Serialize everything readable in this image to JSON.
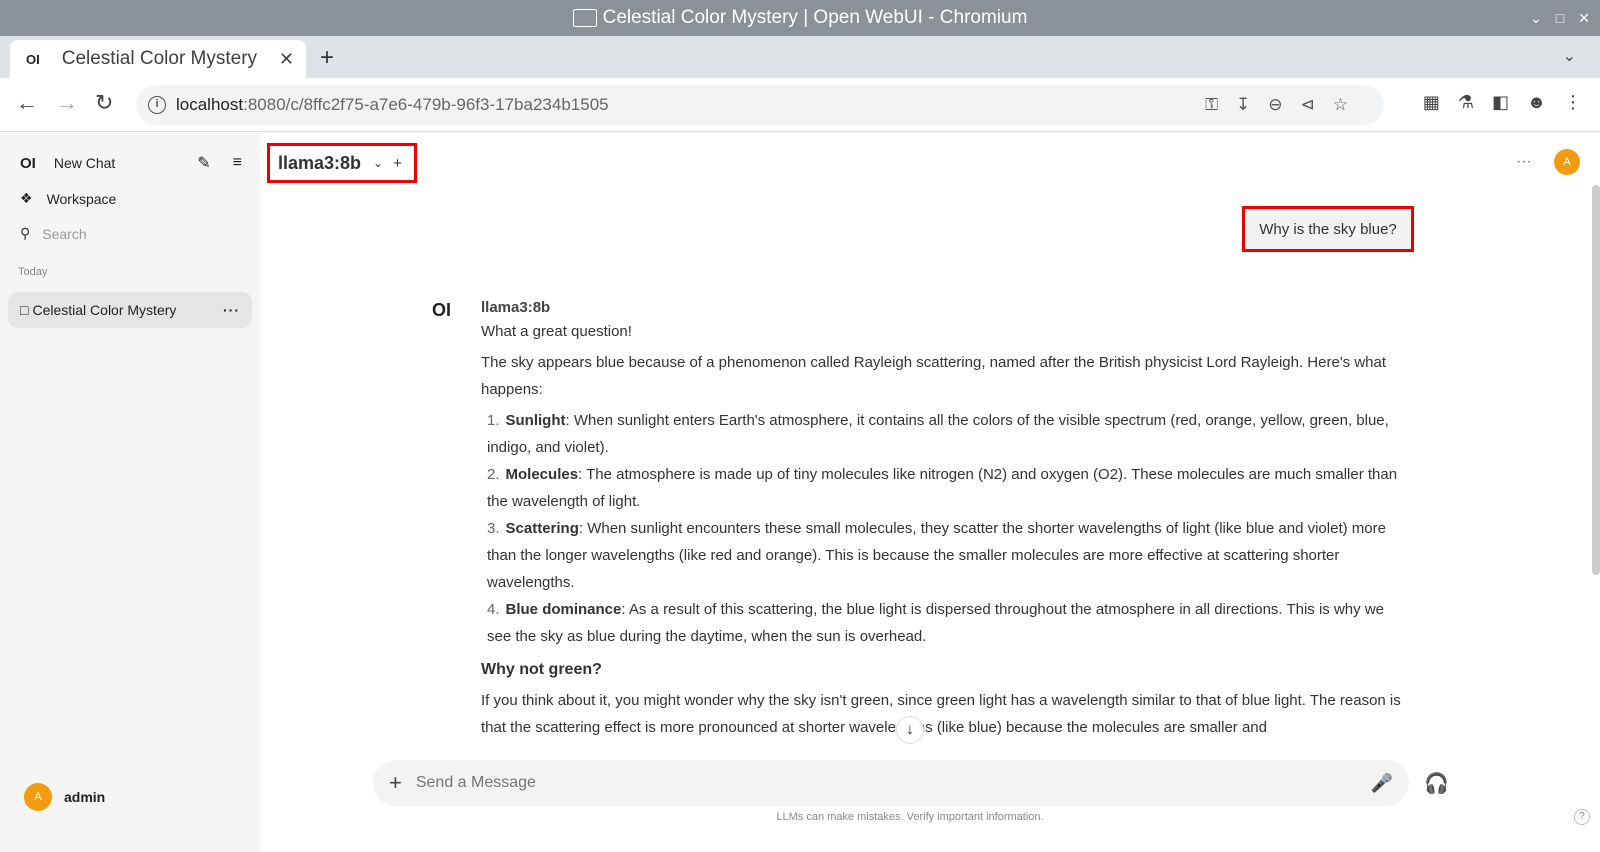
{
  "window": {
    "title": "Celestial Color Mystery | Open WebUI - Chromium"
  },
  "browser": {
    "tab_title": "Celestial Color Mystery",
    "tab_favicon": "OI",
    "url_host": "localhost",
    "url_rest": ":8080/c/8ffc2f75-a7e6-479b-96f3-17ba234b1505"
  },
  "sidebar": {
    "logo": "OI",
    "new_chat": "New Chat",
    "workspace": "Workspace",
    "search_placeholder": "Search",
    "section_today": "Today",
    "chat_item": "Celestial Color Mystery",
    "chat_item_more": "···",
    "user_initial": "A",
    "user_name": "admin"
  },
  "header": {
    "model": "llama3:8b",
    "user_initial": "A",
    "more": "···"
  },
  "conversation": {
    "user_message": "Why is the sky blue?",
    "bot_logo": "OI",
    "model_name": "llama3:8b",
    "intro": "What a great question!",
    "para1": "The sky appears blue because of a phenomenon called Rayleigh scattering, named after the British physicist Lord Rayleigh. Here's what happens:",
    "items": [
      {
        "num": "1.",
        "bold": "Sunlight",
        "text": ": When sunlight enters Earth's atmosphere, it contains all the colors of the visible spectrum (red, orange, yellow, green, blue, indigo, and violet)."
      },
      {
        "num": "2.",
        "bold": "Molecules",
        "text": ": The atmosphere is made up of tiny molecules like nitrogen (N2) and oxygen (O2). These molecules are much smaller than the wavelength of light."
      },
      {
        "num": "3.",
        "bold": "Scattering",
        "text": ": When sunlight encounters these small molecules, they scatter the shorter wavelengths of light (like blue and violet) more than the longer wavelengths (like red and orange). This is because the smaller molecules are more effective at scattering shorter wavelengths."
      },
      {
        "num": "4.",
        "bold": "Blue dominance",
        "text": ": As a result of this scattering, the blue light is dispersed throughout the atmosphere in all directions. This is why we see the sky as blue during the daytime, when the sun is overhead."
      }
    ],
    "heading2": "Why not green?",
    "para2": "If you think about it, you might wonder why the sky isn't green, since green light has a wavelength similar to that of blue light. The reason is that the scattering effect is more pronounced at shorter wavelengths (like blue) because the molecules are smaller and"
  },
  "composer": {
    "placeholder": "Send a Message",
    "disclaimer": "LLMs can make mistakes. Verify important information.",
    "help": "?"
  },
  "colors": {
    "accent_avatar": "#f39c12",
    "highlight_box": "#e00000"
  }
}
